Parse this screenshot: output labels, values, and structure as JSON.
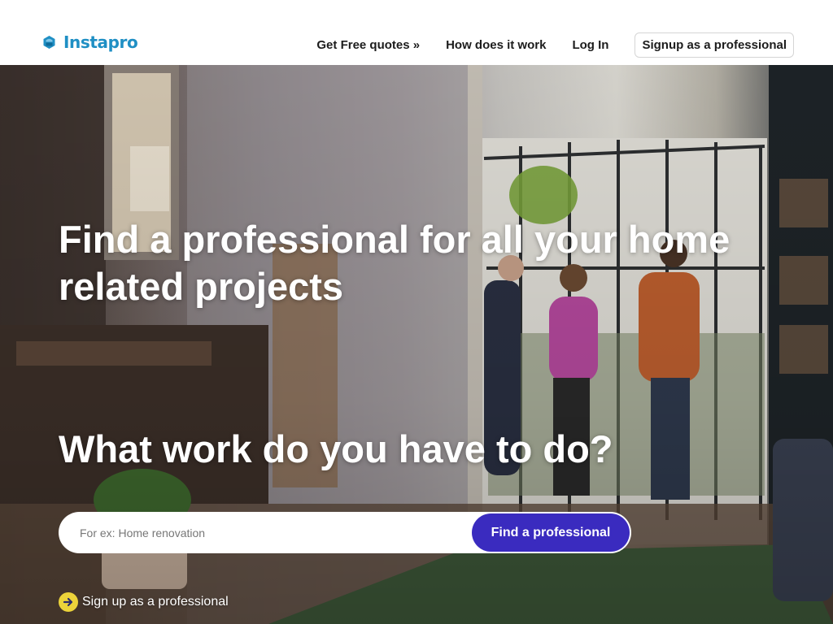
{
  "header": {
    "logo_text": "Instapro",
    "logo_icon": "instapro-logo-icon",
    "brand_color": "#1f8fc4",
    "nav": {
      "get_quotes": "Get Free quotes »",
      "how_it_works": "How does it work",
      "login": "Log In",
      "signup_pro": "Signup as a professional"
    }
  },
  "hero": {
    "title": "Find a professional for all your home related projects",
    "question": "What work do you have to do?",
    "search": {
      "placeholder": "For ex: Home renovation",
      "value": "",
      "button_label": "Find a professional",
      "button_color": "#3a2bbf"
    },
    "signup_link": {
      "label": "Sign up as a professional",
      "icon": "arrow-right-circle-icon",
      "icon_color": "#ecd33a"
    }
  }
}
